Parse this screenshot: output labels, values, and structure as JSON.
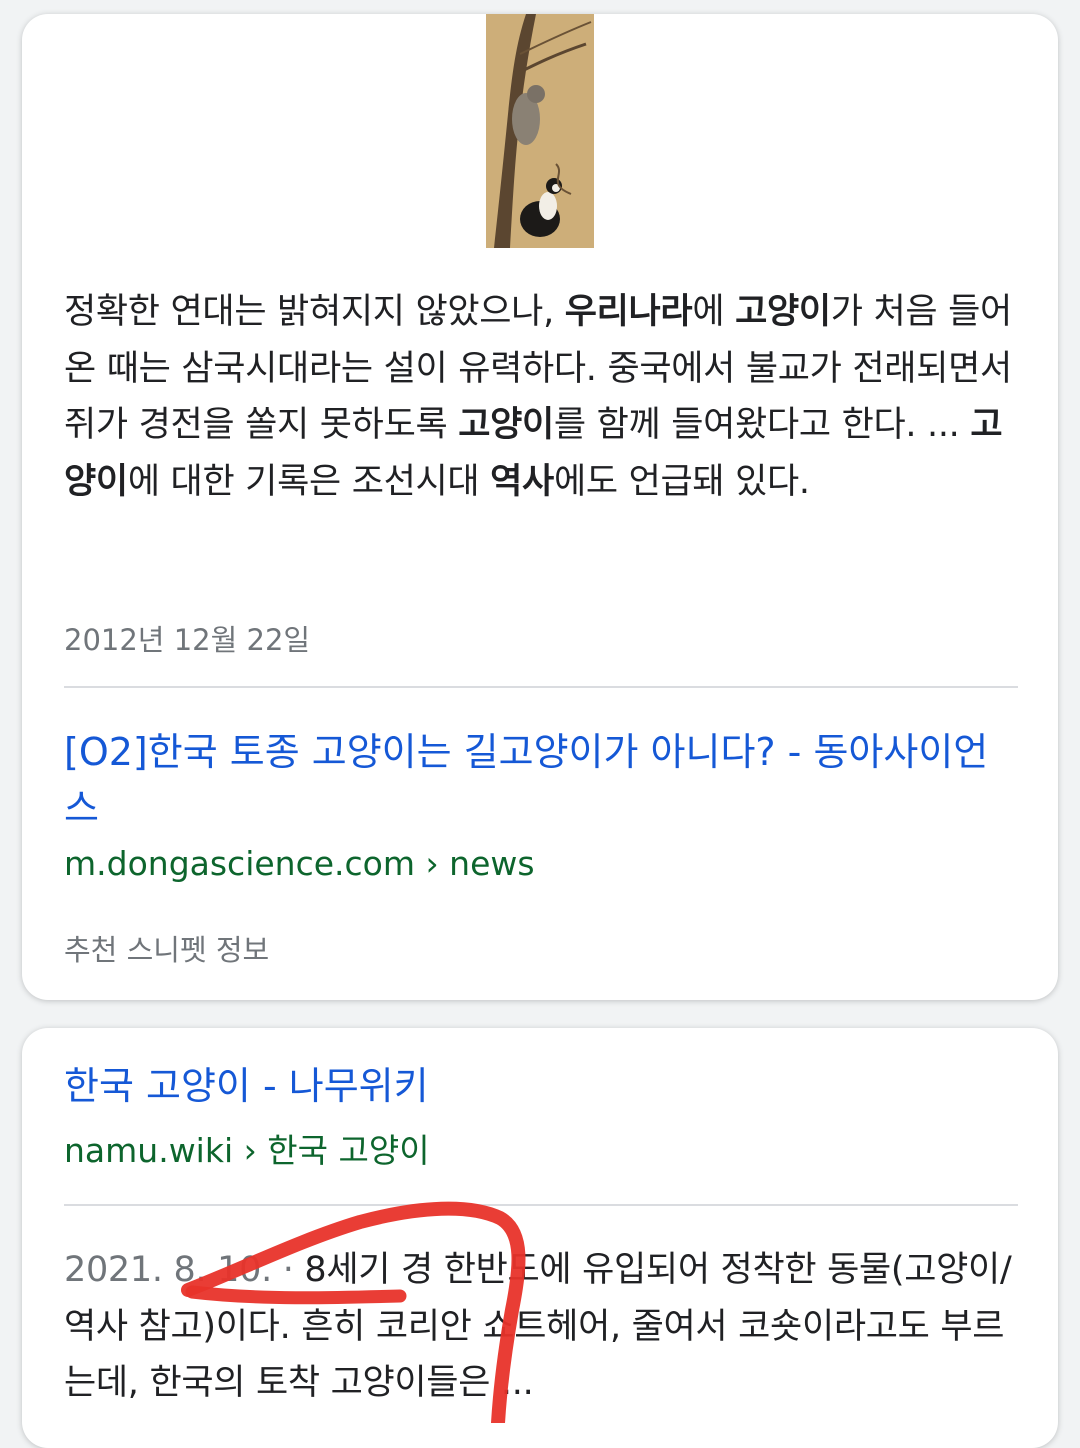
{
  "card1": {
    "snippet": {
      "p1": "정확한 연대는 밝혀지지 않았으나, ",
      "b1": "우리나라",
      "p2": "에 ",
      "b2": "고양이",
      "p3": "가 처음 들어온 때는 삼국시대라는 설이 유력하다. 중국에서 불교가 전래되면서 쥐가 경전을 쏠지 못하도록 ",
      "b3": "고양이",
      "p4": "를 함께 들여왔다고 한다. ... ",
      "b4": "고양이",
      "p5": "에 대한 기록은 조선시대 ",
      "b5": "역사",
      "p6": "에도 언급돼 있다."
    },
    "date": "2012년 12월 22일",
    "result_title": "[O2]한국 토종 고양이는 길고양이가 아니다? - 동아사이언스",
    "result_url": "m.dongascience.com › news",
    "featured_snippet_info": "추천 스니펫 정보"
  },
  "card2": {
    "result_title": "한국 고양이 - 나무위키",
    "result_url": "namu.wiki › 한국 고양이",
    "date": "2021. 8. 10. · ",
    "snippet": "8세기 경 한반도에 유입되어 정착한 동물(고양이/역사 참고)이다. 흔히 코리안 쇼트헤어, 줄여서 코숏이라고도 부르는데, 한국의 토착 고양이들은 ..."
  },
  "colors": {
    "link": "#1558d6",
    "url": "#0d652d",
    "annotation": "#e8332a"
  }
}
